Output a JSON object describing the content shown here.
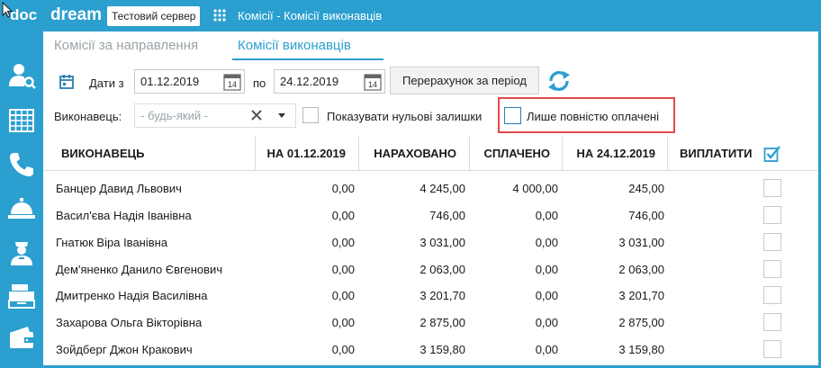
{
  "app": {
    "logo_doc": "doc",
    "logo_dream": "dream",
    "server_badge": "Тестовий сервер",
    "window_title": "Комісії - Комісії виконавців"
  },
  "sidebar": {
    "icons": [
      "user-search-icon",
      "calendar-grid-icon",
      "phone-icon",
      "service-bell-icon",
      "doctor-icon",
      "cash-register-icon",
      "wallet-icon"
    ]
  },
  "tabs": [
    {
      "label": "Комісії за направлення",
      "active": false
    },
    {
      "label": "Комісії виконавців",
      "active": true
    }
  ],
  "filters": {
    "date_from_label": "Дати з",
    "date_from": "01.12.2019",
    "date_to_label": "по",
    "date_to": "24.12.2019",
    "calendar_day": "14",
    "recalc_button": "Перерахунок за період",
    "executor_label": "Виконавець:",
    "executor_placeholder": "- будь-який -",
    "show_zero_label": "Показувати нульові залишки",
    "show_zero_checked": false,
    "only_paid_label": "Лише повністю оплачені",
    "only_paid_checked": false
  },
  "table": {
    "headers": [
      "ВИКОНАВЕЦЬ",
      "НА 01.12.2019",
      "НАРАХОВАНО",
      "СПЛАЧЕНО",
      "НА 24.12.2019",
      "ВИПЛАТИТИ"
    ],
    "rows": [
      [
        "Банцер Давид Львович",
        "0,00",
        "4 245,00",
        "4 000,00",
        "245,00"
      ],
      [
        "Васил'єва Надія Іванівна",
        "0,00",
        "746,00",
        "0,00",
        "746,00"
      ],
      [
        "Гнатюк Віра Іванівна",
        "0,00",
        "3 031,00",
        "0,00",
        "3 031,00"
      ],
      [
        "Дем'яненко Данило Євгенович",
        "0,00",
        "2 063,00",
        "0,00",
        "2 063,00"
      ],
      [
        "Дмитренко Надія Василівна",
        "0,00",
        "3 201,70",
        "0,00",
        "3 201,70"
      ],
      [
        "Захарова Ольга Вікторівна",
        "0,00",
        "2 875,00",
        "0,00",
        "2 875,00"
      ],
      [
        "Зойдберг Джон Кракович",
        "0,00",
        "3 159,80",
        "0,00",
        "3 159,80"
      ]
    ]
  },
  "colors": {
    "accent": "#2b9fcf",
    "highlight": "#e04a4a",
    "muted_text": "#9aa3a8"
  }
}
